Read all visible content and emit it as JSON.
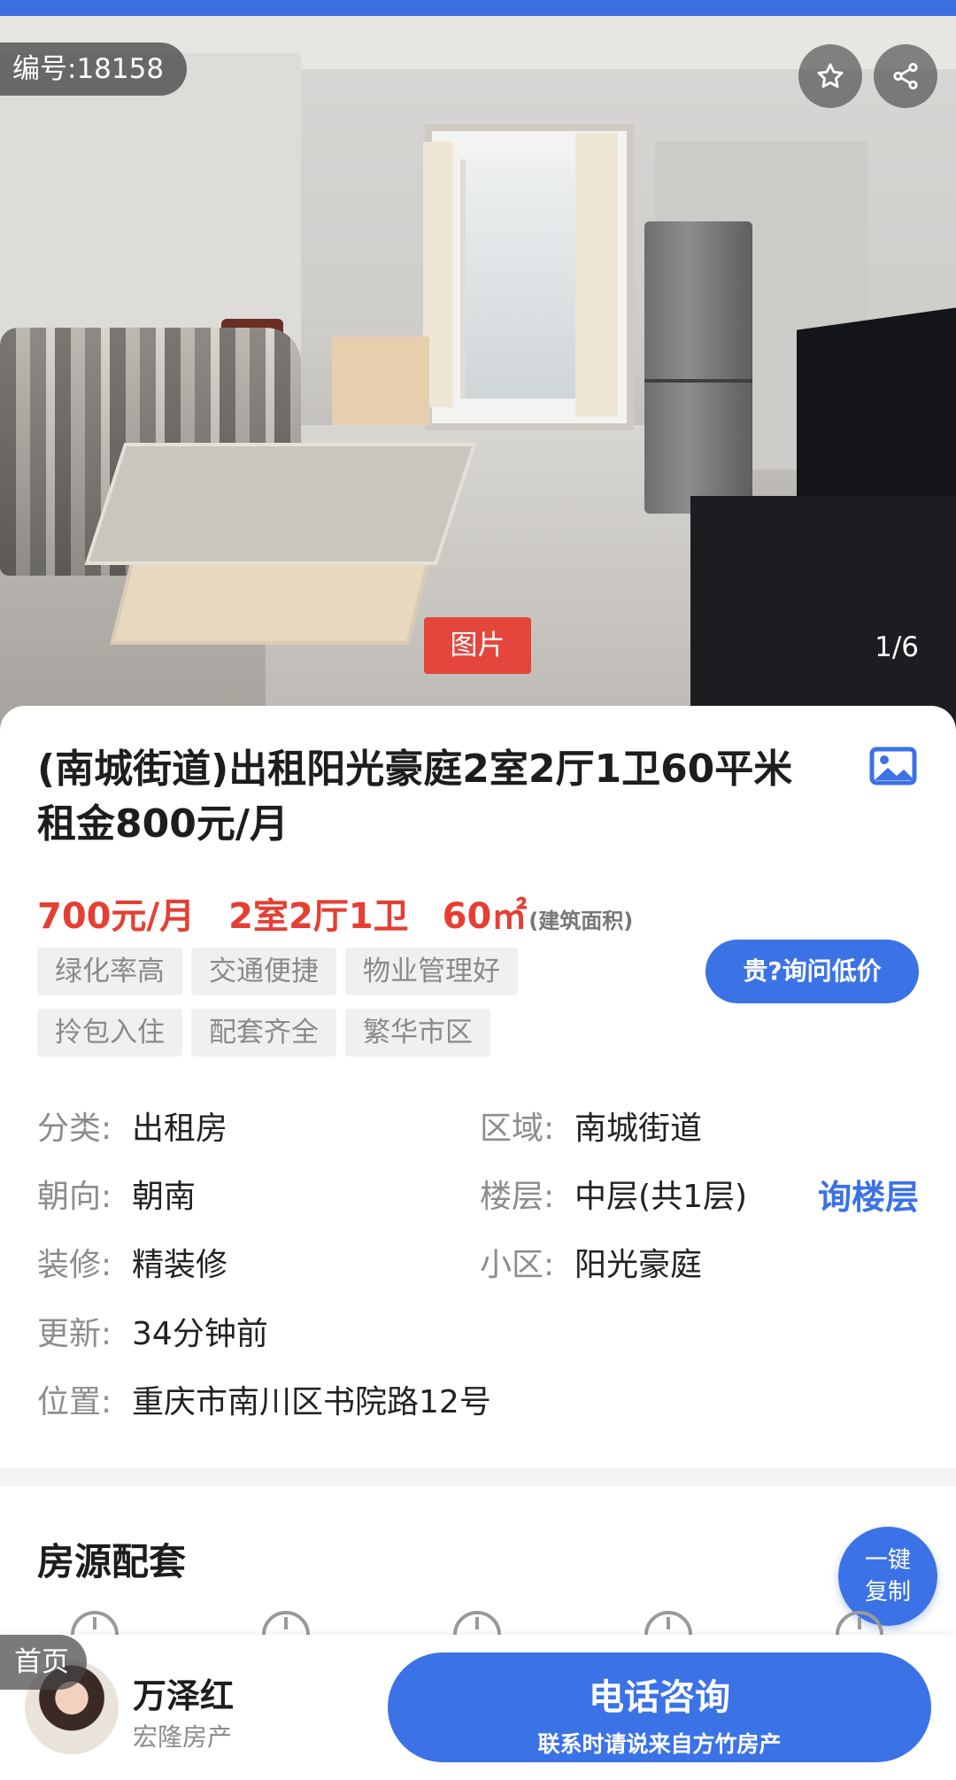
{
  "hero": {
    "listing_id": "编号:18158",
    "photo_tag": "图片",
    "photo_count": "1/6"
  },
  "listing": {
    "title": "(南城街道)出租阳光豪庭2室2厅1卫60平米 租金800元/月",
    "price": "700元/月",
    "layout": "2室2厅1卫",
    "area": "60㎡",
    "area_note": "(建筑面积)",
    "tags": [
      "绿化率高",
      "交通便捷",
      "物业管理好",
      "拎包入住",
      "配套齐全",
      "繁华市区"
    ],
    "ask_price_button": "贵?询问低价"
  },
  "details": {
    "category": {
      "key": "分类:",
      "value": "出租房"
    },
    "region": {
      "key": "区域:",
      "value": "南城街道"
    },
    "orientation": {
      "key": "朝向:",
      "value": "朝南"
    },
    "floor": {
      "key": "楼层:",
      "value": "中层(共1层)"
    },
    "floor_link": "询楼层",
    "decoration": {
      "key": "装修:",
      "value": "精装修"
    },
    "community": {
      "key": "小区:",
      "value": "阳光豪庭"
    },
    "updated": {
      "key": "更新:",
      "value": "34分钟前"
    },
    "location": {
      "key": "位置:",
      "value": "重庆市南川区书院路12号"
    }
  },
  "amenities": {
    "title": "房源配套",
    "copy_button_line1": "一键",
    "copy_button_line2": "复制"
  },
  "bottom_bar": {
    "home_label": "首页",
    "agent_name": "万泽红",
    "agent_company": "宏隆房产",
    "call_label": "电话咨询",
    "call_sub": "联系时请说来自方竹房产"
  },
  "colors": {
    "accent_blue": "#3b72e6",
    "price_red": "#e53f33",
    "tag_bg": "#f0f0f0"
  }
}
